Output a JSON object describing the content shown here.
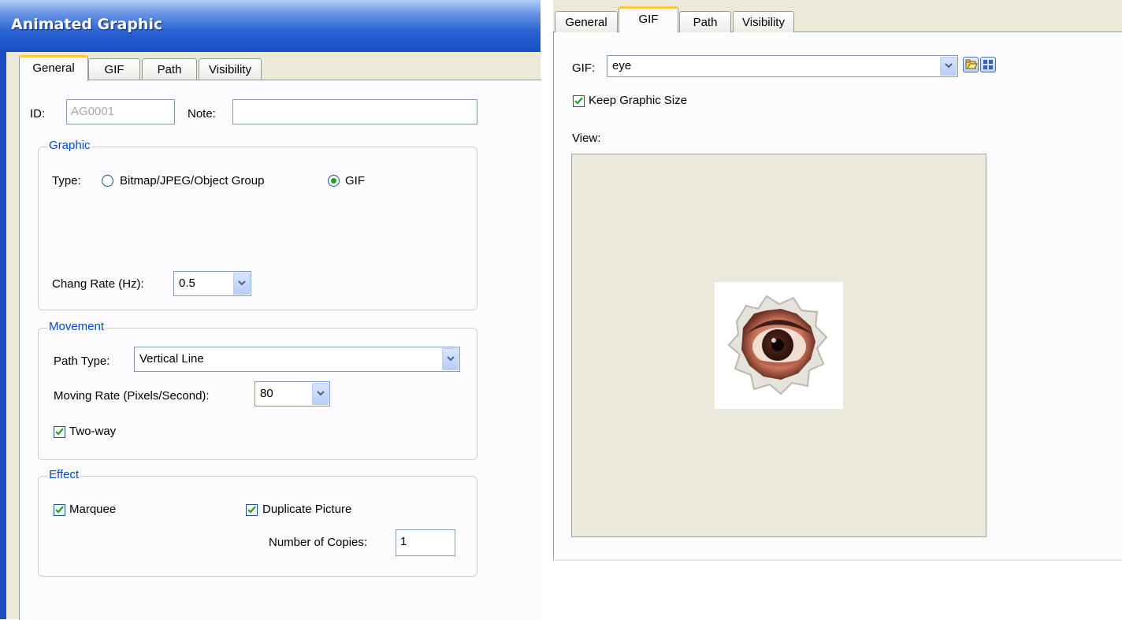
{
  "left_dialog": {
    "title": "Animated Graphic",
    "tabs": [
      "General",
      "GIF",
      "Path",
      "Visibility"
    ],
    "active_tab": "General",
    "id_label": "ID:",
    "id_value": "AG0001",
    "note_label": "Note:",
    "note_value": "",
    "graphic": {
      "label": "Graphic",
      "type_label": "Type:",
      "option_bitmap": "Bitmap/JPEG/Object Group",
      "option_gif": "GIF",
      "selected": "GIF",
      "change_rate_label": "Chang Rate (Hz):",
      "change_rate_value": "0.5"
    },
    "movement": {
      "label": "Movement",
      "path_type_label": "Path Type:",
      "path_type_value": "Vertical Line",
      "moving_rate_label": "Moving Rate (Pixels/Second):",
      "moving_rate_value": "80",
      "two_way_label": "Two-way",
      "two_way_checked": true
    },
    "effect": {
      "label": "Effect",
      "marquee_label": "Marquee",
      "marquee_checked": true,
      "duplicate_label": "Duplicate Picture",
      "duplicate_checked": true,
      "copies_label": "Number of Copies:",
      "copies_value": "1"
    }
  },
  "right_dialog": {
    "tabs": [
      "General",
      "GIF",
      "Path",
      "Visibility"
    ],
    "active_tab": "GIF",
    "gif_label": "GIF:",
    "gif_value": "eye",
    "keep_size_label": "Keep Graphic Size",
    "keep_size_checked": true,
    "view_label": "View:",
    "icons": [
      "open-folder-icon",
      "grid-view-icon"
    ]
  },
  "colors": {
    "titlebar": "#2b62d4",
    "dialog_face": "#ece9d8",
    "group_label": "#0046d5",
    "active_tab_highlight": "#ffc83c",
    "checkmark": "#21a121"
  }
}
